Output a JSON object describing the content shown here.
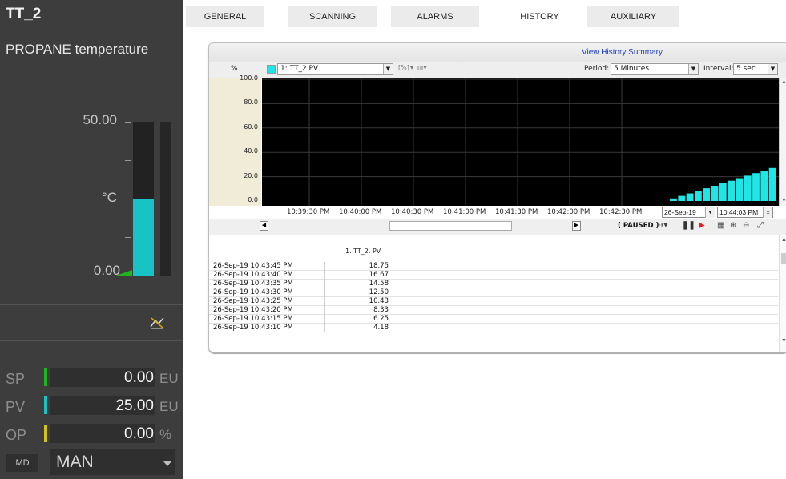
{
  "faceplate": {
    "tag": "TT_2",
    "description": "PROPANE temperature",
    "range_high": "50.00",
    "range_low": "0.00",
    "units": "°C",
    "bar_level": 0.5,
    "sp": {
      "label": "SP",
      "value": "0.00",
      "unit": "EU",
      "color": "#1fb51f"
    },
    "pv": {
      "label": "PV",
      "value": "25.00",
      "unit": "EU",
      "color": "#17c3c3"
    },
    "op": {
      "label": "OP",
      "value": "0.00",
      "unit": "%",
      "color": "#d4c21a"
    },
    "md_label": "MD",
    "mode": "MAN",
    "trend_icon": "trend-icon"
  },
  "tabs": [
    {
      "label": "GENERAL"
    },
    {
      "label": "SCANNING"
    },
    {
      "label": "ALARMS"
    },
    {
      "label": "HISTORY",
      "active": true
    },
    {
      "label": "AUXILIARY"
    }
  ],
  "history": {
    "summary_link": "View History Summary",
    "toolbar": {
      "percent": "%",
      "series_select": "1: TT_2.PV",
      "unit_btn": "[%]",
      "period_label": "Period:",
      "period_value": "5 Minutes",
      "interval_label": "Interval:",
      "interval_value": "5 sec"
    },
    "date": "26-Sep-19",
    "time": "10:44:03 PM",
    "paused": "( PAUSED )",
    "column_header": "1. TT_2. PV",
    "rows": [
      {
        "time": "26-Sep-19 10:43:45 PM",
        "value": "18.75"
      },
      {
        "time": "26-Sep-19 10:43:40 PM",
        "value": "16.67"
      },
      {
        "time": "26-Sep-19 10:43:35 PM",
        "value": "14.58"
      },
      {
        "time": "26-Sep-19 10:43:30 PM",
        "value": "12.50"
      },
      {
        "time": "26-Sep-19 10:43:25 PM",
        "value": "10.43"
      },
      {
        "time": "26-Sep-19 10:43:20 PM",
        "value": "8.33"
      },
      {
        "time": "26-Sep-19 10:43:15 PM",
        "value": "6.25"
      },
      {
        "time": "26-Sep-19 10:43:10 PM",
        "value": "4.18"
      }
    ]
  },
  "chart_data": {
    "type": "bar",
    "series": [
      {
        "name": "1: TT_2.PV",
        "color": "#1ee6e6",
        "x": [
          "10:42:55 PM",
          "10:43:00 PM",
          "10:43:05 PM",
          "10:43:10 PM",
          "10:43:15 PM",
          "10:43:20 PM",
          "10:43:25 PM",
          "10:43:30 PM",
          "10:43:35 PM",
          "10:43:40 PM",
          "10:43:45 PM",
          "10:43:50 PM",
          "10:43:55 PM",
          "10:44:00 PM"
        ],
        "values": [
          0.0,
          2.1,
          4.18,
          6.25,
          8.33,
          10.43,
          12.5,
          14.58,
          16.67,
          18.75,
          20.8,
          22.9,
          25.0,
          27.1
        ]
      }
    ],
    "x_ticks": [
      "10:39:30 PM",
      "10:40:00 PM",
      "10:40:30 PM",
      "10:41:00 PM",
      "10:41:30 PM",
      "10:42:00 PM",
      "10:42:30 PM"
    ],
    "y_ticks": [
      "100.0",
      "80.0",
      "60.0",
      "40.0",
      "20.0",
      "0.0"
    ],
    "ylim": [
      0,
      100
    ],
    "grid": true,
    "background": "#000000"
  }
}
